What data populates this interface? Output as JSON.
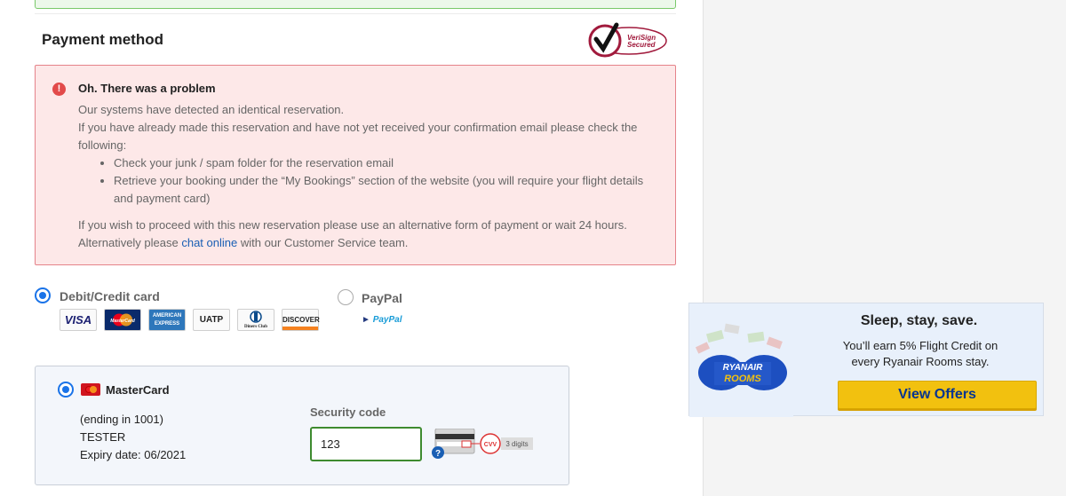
{
  "payment": {
    "title": "Payment method",
    "verisign_label_1": "VeriSign",
    "verisign_label_2": "Secured"
  },
  "alert": {
    "title": "Oh. There was a problem",
    "line1": "Our systems have detected an identical reservation.",
    "line2": "If you have already made this reservation and have not yet received your confirmation email please check the following:",
    "bullets": [
      "Check your junk / spam folder for the reservation email",
      "Retrieve your booking under the “My Bookings” section of the website (you will require your flight details and payment card)"
    ],
    "line3_prefix": "If you wish to proceed with this new reservation please use an alternative form of payment or wait 24 hours. Alternatively please ",
    "link_text": "chat online",
    "line3_suffix": " with our Customer Service team."
  },
  "options": {
    "card_label": "Debit/Credit card",
    "paypal_label": "PayPal",
    "paypal_logo_a": "Pay",
    "paypal_logo_b": "Pal",
    "card_logos": [
      "VISA",
      "MasterCard",
      "AMERICAN EXPRESS",
      "UATP",
      "Diners Club",
      "DISCOVER"
    ]
  },
  "saved_card": {
    "name": "MasterCard",
    "ending": "(ending in 1001)",
    "holder": "TESTER",
    "expiry": "Expiry date: 06/2021",
    "security_label": "Security code",
    "security_value": "123",
    "cvv_label": "CVV",
    "cvv_hint": "3 digits"
  },
  "promo": {
    "title": "Sleep, stay, save.",
    "text": "You’ll earn 5% Flight Credit on every Ryanair Rooms stay.",
    "button": "View Offers",
    "logo_line1": "RYANAIR",
    "logo_line2": "ROOMS"
  },
  "colors": {
    "accent_blue": "#1a73e8",
    "alert_bg": "#fde8e8",
    "alert_border": "#e5838a",
    "input_border": "#3e8b2f",
    "promo_button": "#f2c10f"
  }
}
